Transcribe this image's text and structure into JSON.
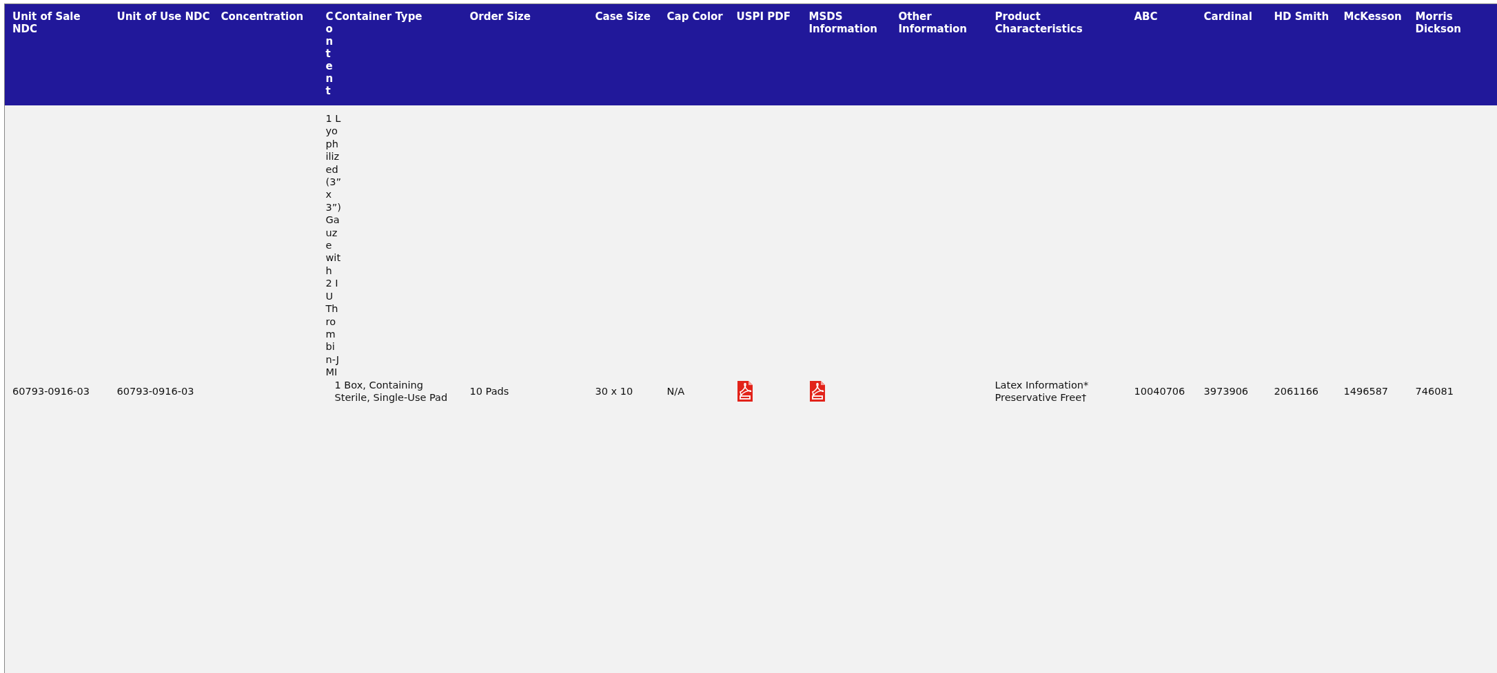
{
  "table": {
    "columns": [
      {
        "label": "Unit of Sale NDC",
        "kind": "text"
      },
      {
        "label": "Unit of Use NDC",
        "kind": "text"
      },
      {
        "label": "Concentration",
        "kind": "text"
      },
      {
        "label": "Content",
        "kind": "vertical"
      },
      {
        "label": "Container Type",
        "kind": "text"
      },
      {
        "label": "Order Size",
        "kind": "text"
      },
      {
        "label": "Case Size",
        "kind": "text"
      },
      {
        "label": "Cap Color",
        "kind": "text"
      },
      {
        "label": "USPI PDF",
        "kind": "text"
      },
      {
        "label": "MSDS Information",
        "kind": "text"
      },
      {
        "label": "Other Information",
        "kind": "text"
      },
      {
        "label": "Product Characteristics",
        "kind": "text"
      },
      {
        "label": "ABC",
        "kind": "text"
      },
      {
        "label": "Cardinal",
        "kind": "text"
      },
      {
        "label": "HD Smith",
        "kind": "text"
      },
      {
        "label": "McKesson",
        "kind": "text"
      },
      {
        "label": "Morris Dickson",
        "kind": "text"
      }
    ],
    "rows": [
      {
        "cells": [
          {
            "kind": "text",
            "text": "60793-0916-03"
          },
          {
            "kind": "text",
            "text": "60793-0916-03"
          },
          {
            "kind": "empty"
          },
          {
            "kind": "vertical",
            "text": "1 Lyophilized (3” x 3”) Gauze with 2 IU Thrombin-JMI"
          },
          {
            "kind": "text",
            "text": "1 Box, Containing Sterile, Single-Use Pad"
          },
          {
            "kind": "text",
            "text": "10 Pads"
          },
          {
            "kind": "text",
            "text": "30 x 10"
          },
          {
            "kind": "text",
            "text": "N/A"
          },
          {
            "kind": "pdf"
          },
          {
            "kind": "pdf"
          },
          {
            "kind": "empty"
          },
          {
            "kind": "lines",
            "lines": [
              "Latex Information*",
              "Preservative Free†"
            ]
          },
          {
            "kind": "text",
            "text": "10040706"
          },
          {
            "kind": "text",
            "text": "3973906"
          },
          {
            "kind": "text",
            "text": "2061166"
          },
          {
            "kind": "text",
            "text": "1496587"
          },
          {
            "kind": "text",
            "text": "746081"
          }
        ]
      }
    ]
  }
}
